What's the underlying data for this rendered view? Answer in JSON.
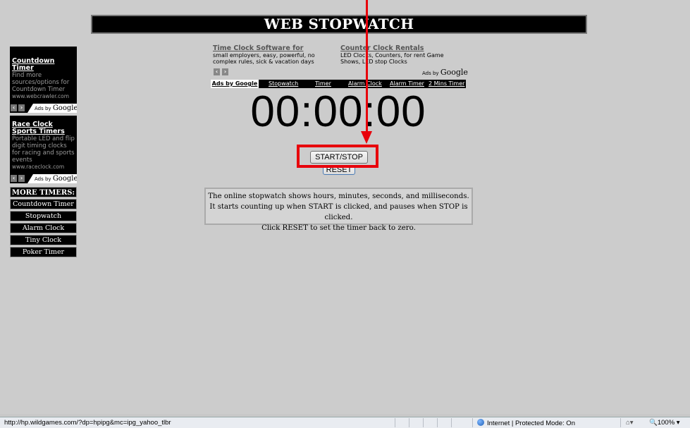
{
  "title": "WEB STOPWATCH",
  "sidebar": {
    "ad1": {
      "title": "Countdown Timer",
      "text": "Find more sources/options for Countdown Timer",
      "url": "www.webcrawler.com"
    },
    "ad2": {
      "title": "Race Clock Sports Timers",
      "text": "Portable LED and flip digit timing clocks for racing and sports events",
      "url": "www.raceclock.com"
    },
    "ads_label": "Ads by",
    "ads_brand": "Google",
    "more_timers": "MORE TIMERS:",
    "links": [
      "Countdown Timer",
      "Stopwatch",
      "Alarm Clock",
      "Tiny Clock",
      "Poker Timer"
    ]
  },
  "top_ads": {
    "ad1": {
      "title": "Time Clock Software for",
      "text": "small employers, easy, powerful, no complex rules, sick & vacation days"
    },
    "ad2": {
      "title": "Counter Clock Rentals",
      "text": "LED Clocks, Counters, for rent Game Shows, LED stop Clocks"
    },
    "ads_label": "Ads by",
    "ads_brand": "Google"
  },
  "nav": {
    "first": "Ads by Google",
    "items": [
      "Stopwatch",
      "Timer",
      "Alarm Clock",
      "Alarm Timer",
      "2 Mins Timer"
    ]
  },
  "timer": "00:00:00",
  "buttons": {
    "start_stop": "START/STOP",
    "reset": "RESET"
  },
  "description": {
    "line1": "The online stopwatch shows hours, minutes, seconds, and milliseconds.",
    "line2": "It starts counting up when START is clicked, and pauses when STOP is clicked.",
    "line3": "Click RESET to set the timer back to zero."
  },
  "status_bar": {
    "url": "http://hp.wildgames.com/?dp=hpipg&mc=ipg_yahoo_tlbr",
    "zone": "Internet | Protected Mode: On",
    "zoom": "100%"
  },
  "colors": {
    "background": "#cccccc",
    "highlight": "#e8000b"
  }
}
